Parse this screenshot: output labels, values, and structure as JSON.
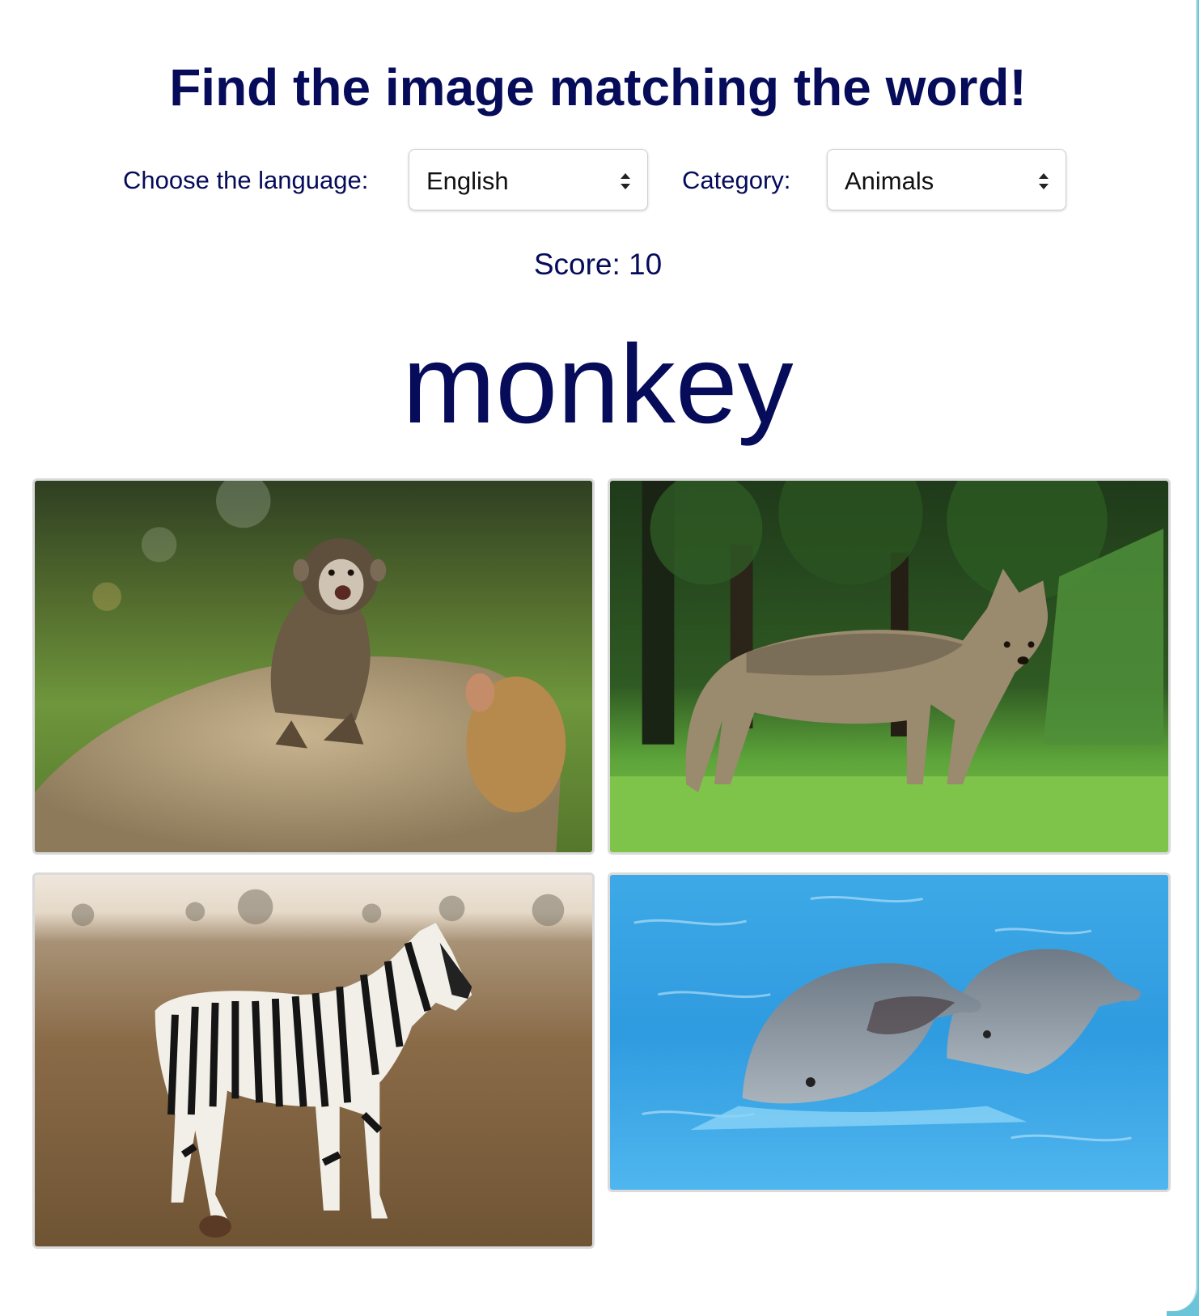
{
  "title": "Find the image matching the word!",
  "controls": {
    "language_label": "Choose the language:",
    "language_value": "English",
    "category_label": "Category:",
    "category_value": "Animals"
  },
  "score": {
    "text": "Score: 10"
  },
  "target_word": "monkey",
  "choices": [
    {
      "depicts": "monkey",
      "icon": "monkey-photo"
    },
    {
      "depicts": "wolf",
      "icon": "wolf-photo"
    },
    {
      "depicts": "zebra",
      "icon": "zebra-photo"
    },
    {
      "depicts": "dolphins",
      "icon": "dolphin-photo"
    }
  ],
  "colors": {
    "heading": "#060b5a",
    "accent_edge": "#6cc4d8",
    "tile_border": "#dadada"
  }
}
